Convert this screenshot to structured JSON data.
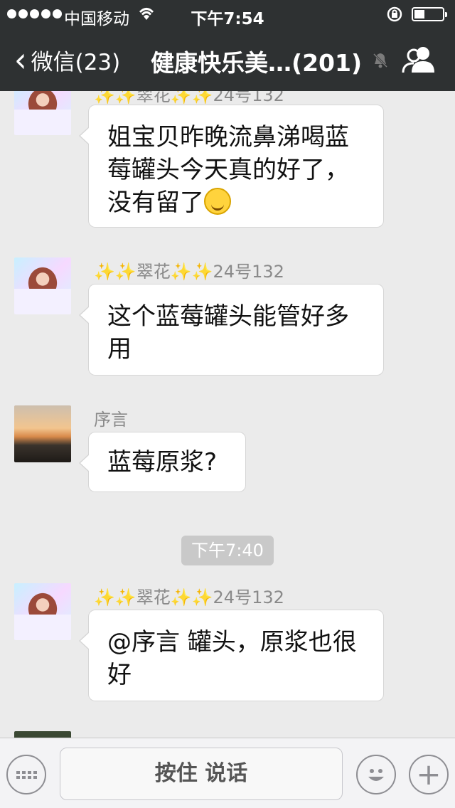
{
  "status_bar": {
    "carrier": "中国移动",
    "time": "下午7:54"
  },
  "nav": {
    "back_label": "微信(23)",
    "title": "健康快乐美…(201)"
  },
  "messages": [
    {
      "sender_name": "翠花",
      "sender_number": "24号132",
      "text": "姐宝贝昨晚流鼻涕喝蓝莓罐头今天真的好了，没有留了",
      "emoji": "smiling-face-icon"
    },
    {
      "sender_name": "翠花",
      "sender_number": "24号132",
      "text": "这个蓝莓罐头能管好多用"
    },
    {
      "sender_name": "序言",
      "text": "蓝莓原浆?"
    },
    {
      "timestamp": "下午7:40"
    },
    {
      "sender_name": "翠花",
      "sender_number": "24号132",
      "text": "@序言 罐头，原浆也很好"
    }
  ],
  "input_bar": {
    "hold_to_talk_label": "按住 说话"
  },
  "colors": {
    "header_bg": "#2e3132",
    "chat_bg": "#ebebeb",
    "bubble_bg": "#ffffff",
    "sparkle": "#f2b52c"
  }
}
